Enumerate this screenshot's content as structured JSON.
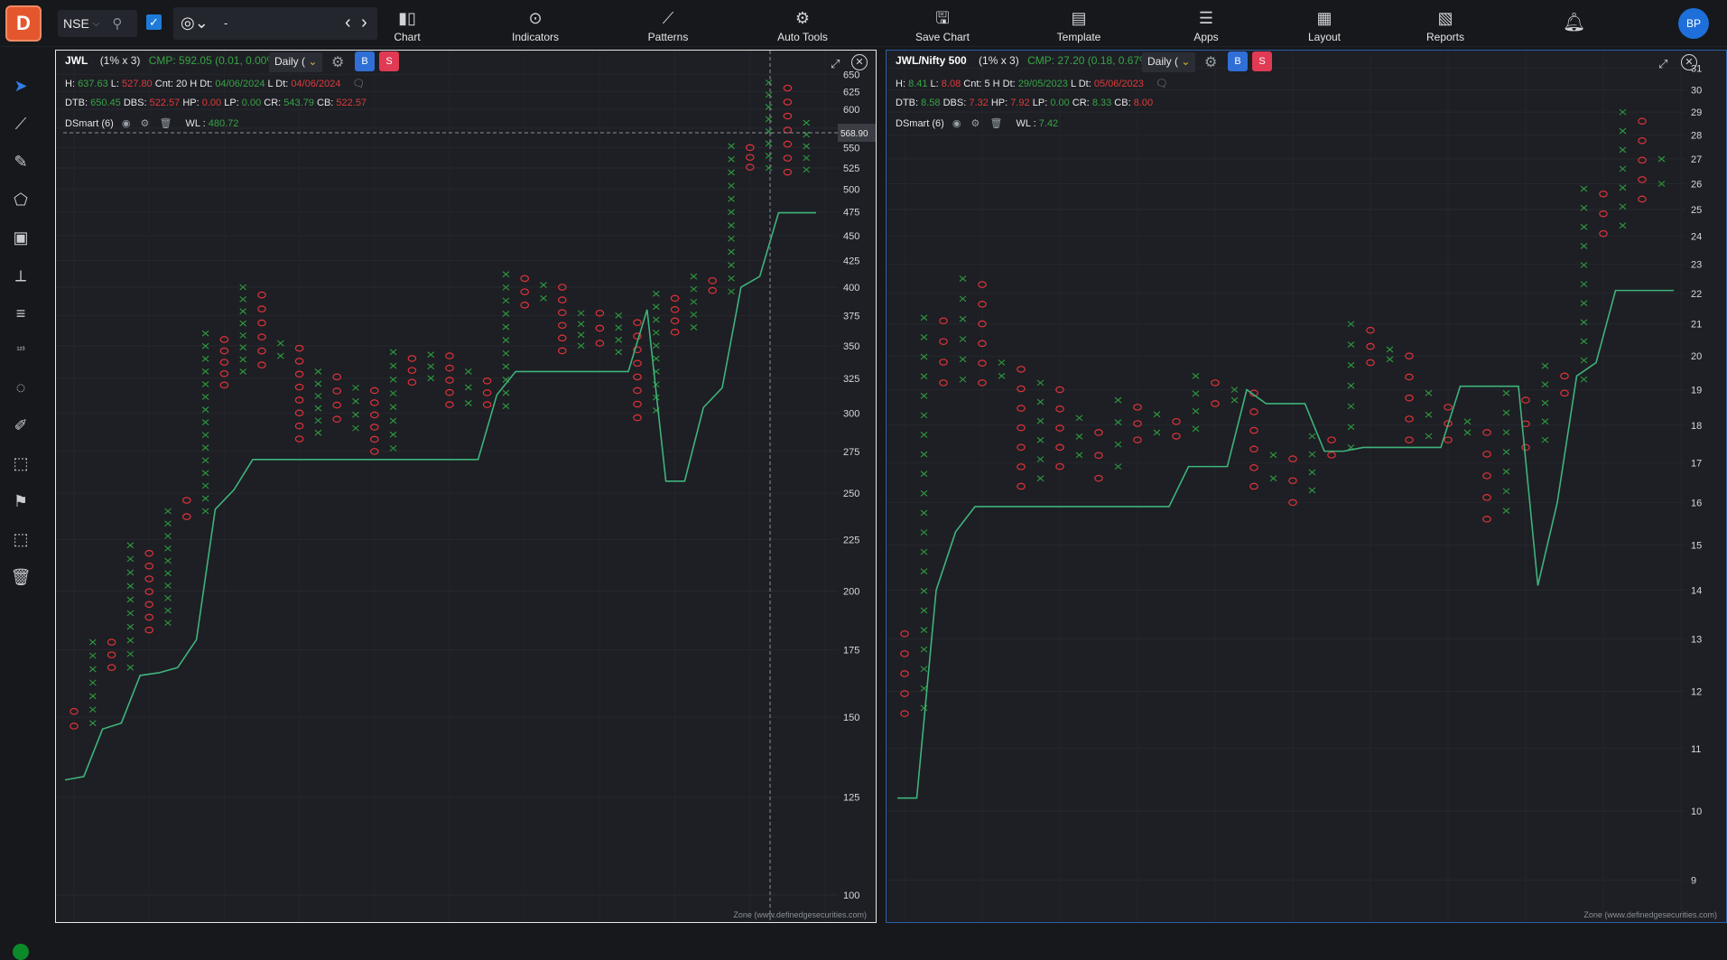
{
  "topbar": {
    "logo_text": "D",
    "exchange": "NSE",
    "symbol_value": "-",
    "menu": [
      {
        "label": "Chart",
        "icon": "candlestick-icon"
      },
      {
        "label": "Indicators",
        "icon": "indicators-icon"
      },
      {
        "label": "Patterns",
        "icon": "patterns-icon"
      },
      {
        "label": "Auto Tools",
        "icon": "auto-tools-icon"
      },
      {
        "label": "Save Chart",
        "icon": "save-icon"
      },
      {
        "label": "Template",
        "icon": "template-icon"
      },
      {
        "label": "Apps",
        "icon": "apps-icon"
      },
      {
        "label": "Layout",
        "icon": "layout-icon"
      },
      {
        "label": "Reports",
        "icon": "reports-icon"
      }
    ],
    "avatar": "BP"
  },
  "sidebar": {
    "tools": [
      "cursor-icon",
      "line-tool-icon",
      "brush-icon",
      "shapes-icon",
      "text-tool-icon",
      "fib-icon",
      "channel-icon",
      "measure-icon",
      "magnet-icon",
      "ruler-icon",
      "pattern-tool-icon",
      "flag-icon",
      "hide-tools-icon",
      "trash-icon"
    ]
  },
  "left_chart": {
    "symbol": "JWL",
    "box": "(1% x 3)",
    "cmp": "CMP: 592.05 (0.01, 0.00%)",
    "timeframe": "Daily (",
    "b_label": "B",
    "s_label": "S",
    "line1": {
      "h_label": "H:",
      "h": "637.63",
      "l_label": "L:",
      "l": "527.80",
      "cnt": "Cnt: 20 H Dt:",
      "hdt": "04/06/2024",
      "ldt_label": "L Dt:",
      "ldt": "04/06/2024"
    },
    "line2": {
      "dtb_label": "DTB:",
      "dtb": "650.45",
      "dbs_label": "DBS:",
      "dbs": "522.57",
      "hp_label": "HP:",
      "hp": "0.00",
      "lp_label": "LP:",
      "lp": "0.00",
      "cr_label": "CR:",
      "cr": "543.79",
      "cb_label": "CB:",
      "cb": "522.57"
    },
    "indicator": {
      "name": "DSmart (6)",
      "wl_label": "WL :",
      "wl": "480.72"
    },
    "price_label": "568.90",
    "zone": "Zone (www.definedgesecurities.com)",
    "chart_data": {
      "type": "point-and-figure",
      "ylabel_ticks": [
        "650",
        "625",
        "600",
        "575",
        "550",
        "525",
        "500",
        "475",
        "450",
        "425",
        "400",
        "375",
        "350",
        "325",
        "300",
        "275",
        "250",
        "225",
        "200",
        "175",
        "150",
        "125",
        "100"
      ],
      "scale": "log",
      "ylim": [
        100,
        675
      ],
      "columns": [
        {
          "t": "O",
          "lo": 147,
          "hi": 152
        },
        {
          "t": "X",
          "lo": 148,
          "hi": 178
        },
        {
          "t": "O",
          "lo": 168,
          "hi": 178
        },
        {
          "t": "X",
          "lo": 168,
          "hi": 222
        },
        {
          "t": "O",
          "lo": 183,
          "hi": 218
        },
        {
          "t": "X",
          "lo": 186,
          "hi": 240
        },
        {
          "t": "O",
          "lo": 237,
          "hi": 246
        },
        {
          "t": "X",
          "lo": 240,
          "hi": 360
        },
        {
          "t": "O",
          "lo": 320,
          "hi": 355
        },
        {
          "t": "X",
          "lo": 330,
          "hi": 400
        },
        {
          "t": "O",
          "lo": 335,
          "hi": 393
        },
        {
          "t": "X",
          "lo": 342,
          "hi": 352
        },
        {
          "t": "O",
          "lo": 283,
          "hi": 348
        },
        {
          "t": "X",
          "lo": 287,
          "hi": 330
        },
        {
          "t": "O",
          "lo": 296,
          "hi": 326
        },
        {
          "t": "X",
          "lo": 290,
          "hi": 318
        },
        {
          "t": "O",
          "lo": 275,
          "hi": 316
        },
        {
          "t": "X",
          "lo": 277,
          "hi": 345
        },
        {
          "t": "O",
          "lo": 322,
          "hi": 340
        },
        {
          "t": "X",
          "lo": 325,
          "hi": 343
        },
        {
          "t": "O",
          "lo": 306,
          "hi": 342
        },
        {
          "t": "X",
          "lo": 307,
          "hi": 330
        },
        {
          "t": "O",
          "lo": 306,
          "hi": 323
        },
        {
          "t": "X",
          "lo": 305,
          "hi": 412
        },
        {
          "t": "O",
          "lo": 384,
          "hi": 408
        },
        {
          "t": "X",
          "lo": 390,
          "hi": 402
        },
        {
          "t": "O",
          "lo": 346,
          "hi": 400
        },
        {
          "t": "X",
          "lo": 350,
          "hi": 377
        },
        {
          "t": "O",
          "lo": 352,
          "hi": 377
        },
        {
          "t": "X",
          "lo": 345,
          "hi": 375
        },
        {
          "t": "O",
          "lo": 297,
          "hi": 369
        },
        {
          "t": "X",
          "lo": 302,
          "hi": 394
        },
        {
          "t": "O",
          "lo": 361,
          "hi": 390
        },
        {
          "t": "X",
          "lo": 365,
          "hi": 410
        },
        {
          "t": "O",
          "lo": 397,
          "hi": 406
        },
        {
          "t": "X",
          "lo": 396,
          "hi": 552
        },
        {
          "t": "O",
          "lo": 526,
          "hi": 550
        },
        {
          "t": "X",
          "lo": 525,
          "hi": 638
        },
        {
          "t": "O",
          "lo": 520,
          "hi": 630
        },
        {
          "t": "X",
          "lo": 523,
          "hi": 582
        }
      ],
      "line": [
        130,
        131,
        146,
        148,
        165,
        166,
        168,
        179,
        241,
        252,
        270,
        270,
        270,
        270,
        270,
        270,
        270,
        270,
        270,
        270,
        270,
        270,
        270,
        313,
        330,
        330,
        330,
        330,
        330,
        330,
        330,
        380,
        257,
        257,
        304,
        318,
        400,
        410,
        474,
        474,
        474
      ]
    }
  },
  "right_chart": {
    "symbol": "JWL/Nifty 500",
    "box": "(1% x 3)",
    "cmp": "CMP: 27.20 (0.18, 0.67%)",
    "timeframe": "Daily (",
    "b_label": "B",
    "s_label": "S",
    "line1": {
      "h_label": "H:",
      "h": "8.41",
      "l_label": "L:",
      "l": "8.08",
      "cnt": "Cnt: 5 H Dt:",
      "hdt": "29/05/2023",
      "ldt_label": "L Dt:",
      "ldt": "05/06/2023"
    },
    "line2": {
      "dtb_label": "DTB:",
      "dtb": "8.58",
      "dbs_label": "DBS:",
      "dbs": "7.32",
      "hp_label": "HP:",
      "hp": "7.92",
      "lp_label": "LP:",
      "lp": "0.00",
      "cr_label": "CR:",
      "cr": "8.33",
      "cb_label": "CB:",
      "cb": "8.00"
    },
    "indicator": {
      "name": "DSmart (6)",
      "wl_label": "WL :",
      "wl": "7.42"
    },
    "zone": "Zone (www.definedgesecurities.com)",
    "chart_data": {
      "type": "point-and-figure",
      "ylabel_ticks": [
        "31",
        "30",
        "29",
        "28",
        "27",
        "26",
        "25",
        "24",
        "23",
        "22",
        "21",
        "20",
        "19",
        "18",
        "17",
        "16",
        "15",
        "14",
        "13",
        "12",
        "11",
        "10",
        "9"
      ],
      "scale": "log",
      "ylim": [
        8.8,
        31.5
      ],
      "columns": [
        {
          "t": "O",
          "lo": 11.6,
          "hi": 13.1
        },
        {
          "t": "X",
          "lo": 11.7,
          "hi": 21.2
        },
        {
          "t": "O",
          "lo": 19.2,
          "hi": 21.1
        },
        {
          "t": "X",
          "lo": 19.3,
          "hi": 22.5
        },
        {
          "t": "O",
          "lo": 19.2,
          "hi": 22.3
        },
        {
          "t": "X",
          "lo": 19.4,
          "hi": 19.8
        },
        {
          "t": "O",
          "lo": 16.4,
          "hi": 19.6
        },
        {
          "t": "X",
          "lo": 16.6,
          "hi": 19.2
        },
        {
          "t": "O",
          "lo": 16.9,
          "hi": 19.0
        },
        {
          "t": "X",
          "lo": 17.2,
          "hi": 18.2
        },
        {
          "t": "O",
          "lo": 16.6,
          "hi": 17.8
        },
        {
          "t": "X",
          "lo": 16.9,
          "hi": 18.7
        },
        {
          "t": "O",
          "lo": 17.6,
          "hi": 18.5
        },
        {
          "t": "X",
          "lo": 17.8,
          "hi": 18.3
        },
        {
          "t": "O",
          "lo": 17.7,
          "hi": 18.1
        },
        {
          "t": "X",
          "lo": 17.9,
          "hi": 19.4
        },
        {
          "t": "O",
          "lo": 18.6,
          "hi": 19.2
        },
        {
          "t": "X",
          "lo": 18.7,
          "hi": 19.0
        },
        {
          "t": "O",
          "lo": 16.4,
          "hi": 18.9
        },
        {
          "t": "X",
          "lo": 16.6,
          "hi": 17.2
        },
        {
          "t": "O",
          "lo": 16.0,
          "hi": 17.1
        },
        {
          "t": "X",
          "lo": 16.3,
          "hi": 17.7
        },
        {
          "t": "O",
          "lo": 17.2,
          "hi": 17.6
        },
        {
          "t": "X",
          "lo": 17.4,
          "hi": 21.0
        },
        {
          "t": "O",
          "lo": 19.8,
          "hi": 20.8
        },
        {
          "t": "X",
          "lo": 19.9,
          "hi": 20.2
        },
        {
          "t": "O",
          "lo": 17.6,
          "hi": 20.0
        },
        {
          "t": "X",
          "lo": 17.7,
          "hi": 18.9
        },
        {
          "t": "O",
          "lo": 17.6,
          "hi": 18.5
        },
        {
          "t": "X",
          "lo": 17.8,
          "hi": 18.1
        },
        {
          "t": "O",
          "lo": 15.6,
          "hi": 17.8
        },
        {
          "t": "X",
          "lo": 15.8,
          "hi": 18.9
        },
        {
          "t": "O",
          "lo": 17.4,
          "hi": 18.7
        },
        {
          "t": "X",
          "lo": 17.6,
          "hi": 19.7
        },
        {
          "t": "O",
          "lo": 18.9,
          "hi": 19.4
        },
        {
          "t": "X",
          "lo": 19.3,
          "hi": 25.8
        },
        {
          "t": "O",
          "lo": 24.1,
          "hi": 25.6
        },
        {
          "t": "X",
          "lo": 24.4,
          "hi": 29.0
        },
        {
          "t": "O",
          "lo": 25.4,
          "hi": 28.6
        },
        {
          "t": "X",
          "lo": 26.0,
          "hi": 27.0
        }
      ],
      "line": [
        10.2,
        10.2,
        14.0,
        15.3,
        15.9,
        15.9,
        15.9,
        15.9,
        15.9,
        15.9,
        15.9,
        15.9,
        15.9,
        15.9,
        15.9,
        16.9,
        16.9,
        16.9,
        19.0,
        18.6,
        18.6,
        18.6,
        17.3,
        17.3,
        17.4,
        17.4,
        17.4,
        17.4,
        17.4,
        19.1,
        19.1,
        19.1,
        19.1,
        14.1,
        16.0,
        19.4,
        19.8,
        22.1,
        22.1,
        22.1,
        22.1
      ]
    }
  }
}
